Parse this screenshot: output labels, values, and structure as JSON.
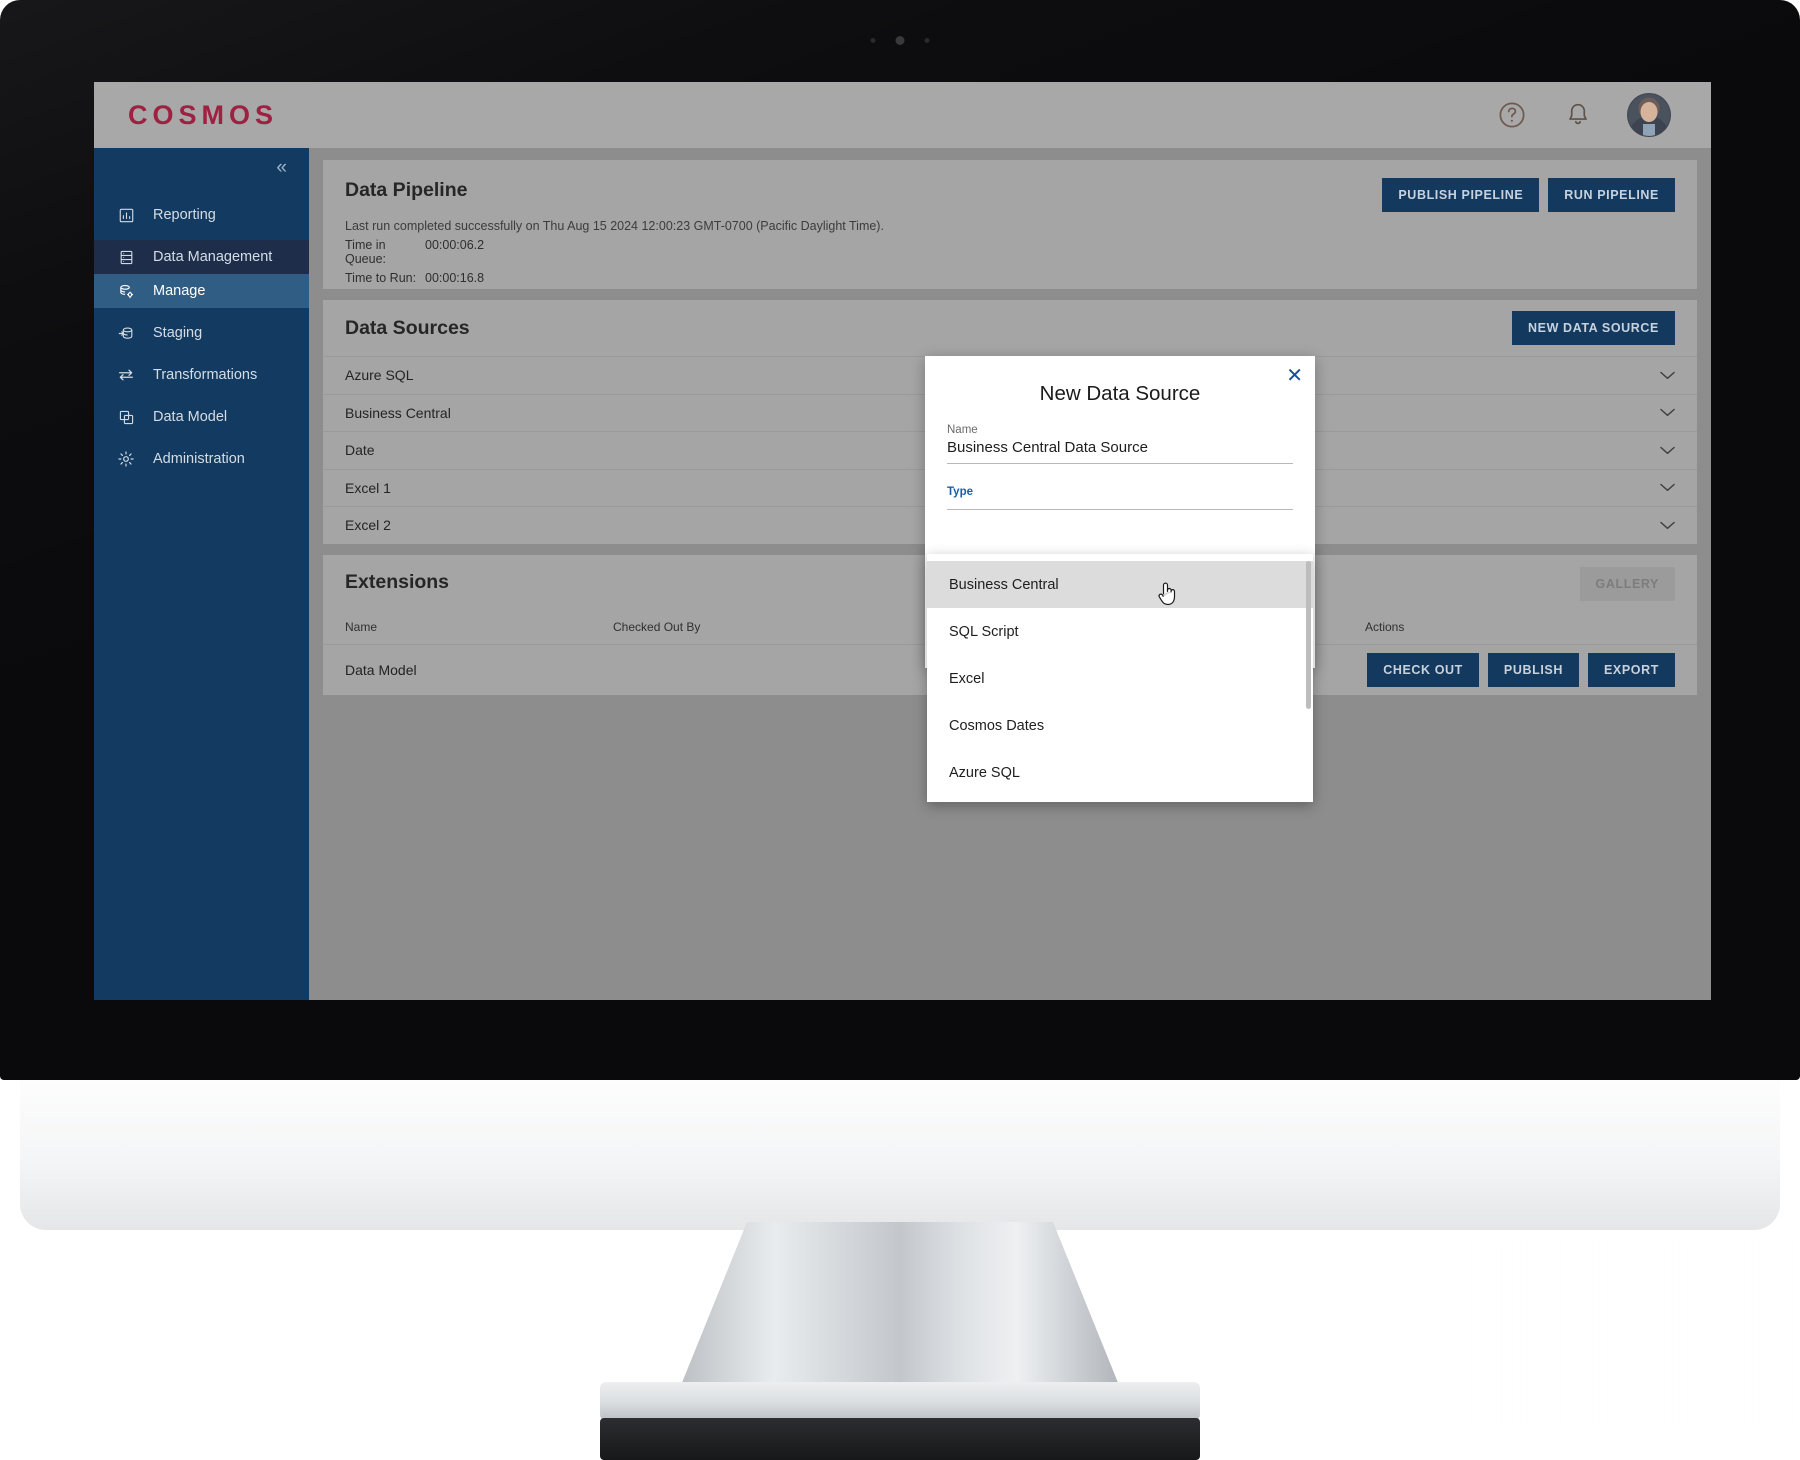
{
  "brand": "COSMOS",
  "header": {
    "help_icon": "help-circle-icon",
    "bell_icon": "bell-icon",
    "avatar_label": "User avatar"
  },
  "sidebar": {
    "collapse_glyph": "«",
    "items": [
      {
        "label": "Reporting",
        "icon": "chart-report-icon",
        "state": "normal"
      },
      {
        "label": "Data Management",
        "icon": "database-stack-icon",
        "state": "selected"
      },
      {
        "label": "Manage",
        "icon": "database-gear-icon",
        "state": "active"
      },
      {
        "label": "Staging",
        "icon": "database-arrow-icon",
        "state": "normal"
      },
      {
        "label": "Transformations",
        "icon": "transform-arrows-icon",
        "state": "normal"
      },
      {
        "label": "Data Model",
        "icon": "data-model-icon",
        "state": "normal"
      },
      {
        "label": "Administration",
        "icon": "gear-icon",
        "state": "normal"
      }
    ]
  },
  "pipeline": {
    "title": "Data Pipeline",
    "status": "Last run completed successfully on Thu Aug 15 2024 12:00:23 GMT-0700 (Pacific Daylight Time).",
    "queue_label": "Time in Queue:",
    "queue_value": "00:00:06.2",
    "run_label": "Time to Run:",
    "run_value": "00:00:16.8",
    "publish_button": "PUBLISH PIPELINE",
    "run_button": "RUN PIPELINE"
  },
  "data_sources": {
    "title": "Data Sources",
    "new_button": "NEW DATA SOURCE",
    "chevron_glyph": "⌄",
    "rows": [
      {
        "name": "Azure SQL"
      },
      {
        "name": "Business Central"
      },
      {
        "name": "Date"
      },
      {
        "name": "Excel 1"
      },
      {
        "name": "Excel 2"
      }
    ]
  },
  "extensions": {
    "title": "Extensions",
    "gallery_button": "GALLERY",
    "columns": [
      "Name",
      "Checked Out By",
      "Actions"
    ],
    "rows": [
      {
        "name": "Data Model",
        "checked_out_by": "",
        "actions": [
          "CHECK OUT",
          "PUBLISH",
          "EXPORT"
        ]
      }
    ]
  },
  "modal": {
    "title": "New Data Source",
    "close_glyph": "✕",
    "name_label": "Name",
    "name_value": "Business Central Data Source",
    "name_placeholder": "Name",
    "type_label": "Type",
    "type_value": "",
    "options": [
      {
        "label": "Business Central",
        "hovered": true
      },
      {
        "label": "SQL Script",
        "hovered": false
      },
      {
        "label": "Excel",
        "hovered": false
      },
      {
        "label": "Cosmos Dates",
        "hovered": false
      },
      {
        "label": "Azure SQL",
        "hovered": false
      }
    ],
    "cursor_icon": "pointer-hand-cursor"
  },
  "colors": {
    "brand_red": "#9e2141",
    "sidebar_navy": "#133A60",
    "sidebar_active": "#2f5d84",
    "sidebar_selected": "#1e2d4a",
    "button_navy": "#14395f",
    "screen_gray": "#8d8d8d",
    "card_gray": "#a5a5a5",
    "header_gray": "#a8a8a8",
    "accent_blue": "#1b5fa8"
  }
}
